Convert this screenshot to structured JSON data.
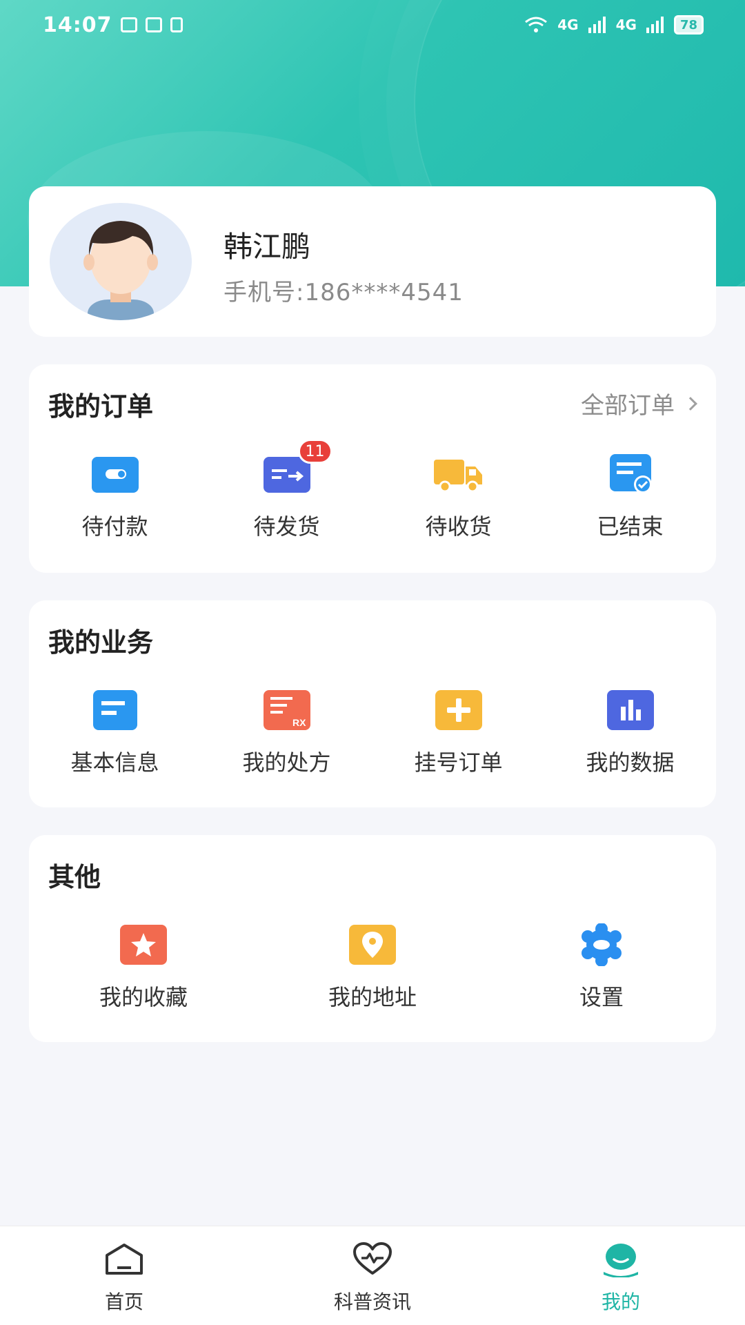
{
  "status_bar": {
    "time": "14:07",
    "battery": "78",
    "signal1": "4G",
    "signal2": "4G"
  },
  "profile": {
    "name": "韩江鹏",
    "phone": "手机号:186****4541"
  },
  "orders": {
    "title": "我的订单",
    "all_link": "全部订单",
    "items": [
      {
        "label": "待付款",
        "icon": "wallet-icon"
      },
      {
        "label": "待发货",
        "icon": "shipping-list-icon",
        "badge": "11"
      },
      {
        "label": "待收货",
        "icon": "truck-icon"
      },
      {
        "label": "已结束",
        "icon": "completed-doc-icon"
      }
    ]
  },
  "business": {
    "title": "我的业务",
    "items": [
      {
        "label": "基本信息",
        "icon": "info-card-icon"
      },
      {
        "label": "我的处方",
        "icon": "prescription-rx-icon"
      },
      {
        "label": "挂号订单",
        "icon": "plus-register-icon"
      },
      {
        "label": "我的数据",
        "icon": "bar-chart-icon"
      }
    ]
  },
  "other": {
    "title": "其他",
    "items": [
      {
        "label": "我的收藏",
        "icon": "star-icon"
      },
      {
        "label": "我的地址",
        "icon": "location-pin-icon"
      },
      {
        "label": "设置",
        "icon": "gear-icon"
      }
    ]
  },
  "tabbar": {
    "items": [
      {
        "label": "首页",
        "icon": "home-icon"
      },
      {
        "label": "科普资讯",
        "icon": "heart-pulse-icon"
      },
      {
        "label": "我的",
        "icon": "profile-icon",
        "active": true
      }
    ],
    "active_color": "#1fb5a5"
  },
  "colors": {
    "header": "#2ec4b3",
    "badge": "#e8403a"
  }
}
